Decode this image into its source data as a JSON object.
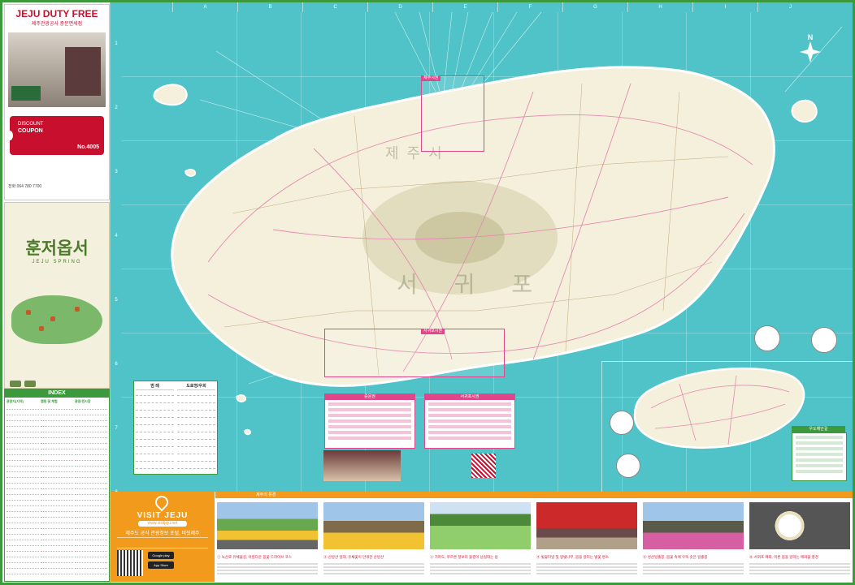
{
  "ad": {
    "logo": "JEJU DUTY FREE",
    "sub": "제주관광공사 중문면세점",
    "coupon_label": "DISCOUNT",
    "coupon_title": "COUPON",
    "coupon_no": "No.4005",
    "phone_label": "전화",
    "phone": "064 780 7700"
  },
  "tour": {
    "title": "훈저옵서",
    "subtitle": "JEJU SPRING"
  },
  "index": {
    "title": "INDEX",
    "headers": [
      "관광지(지역)",
      "캠핑 및 체험",
      "관광/전시장"
    ]
  },
  "map": {
    "columns": [
      "A",
      "B",
      "C",
      "D",
      "E",
      "F",
      "G",
      "H",
      "I",
      "J"
    ],
    "rows": [
      "1",
      "2",
      "3",
      "4",
      "5",
      "6",
      "7",
      "8"
    ],
    "compass": "N",
    "region_seogwipo": "서 귀 포",
    "region_jeju": "제주시",
    "callout_jeju": "제주시권",
    "callout_seogwipo": "서귀포시권",
    "legend_title_1": "범 례",
    "legend_title_2": "도로명/우회",
    "pink_box_1": "중문권",
    "pink_box_2": "서귀포시권",
    "udo_title": "우도해안길"
  },
  "visit": {
    "title": "VISIT JEJU",
    "url": "www.visitjeju.net",
    "subtitle": "제주도 공식 관광정보 포털, 비짓제주",
    "store_google": "Google play",
    "store_apple": "App Store"
  },
  "beauty": {
    "title": "제주의 풍경",
    "captions": [
      "① 녹산로 유채꽃길, 아름다운 봄꽃 드라이브 코스",
      "② 산방산 일대, 유채꽃이 만개한 산방산",
      "③ 가파도, 푸르른 청보리 물결이 넘실대는 섬",
      "④ 벚꽃터널 및 왕벚나무, 봄을 알리는 벚꽃 명소",
      "⑤ 성산일출봉, 봄꽃 속에 우뚝 솟은 일출봉",
      "⑥ 서귀포 매화, 이른 봄을 알리는 매화꽃 풍경"
    ]
  },
  "colors": {
    "sea": "#4fc3c8",
    "land": "#f4f0dc",
    "accent": "#3c9a3c",
    "pink": "#e0468a",
    "orange": "#f29a1c"
  }
}
